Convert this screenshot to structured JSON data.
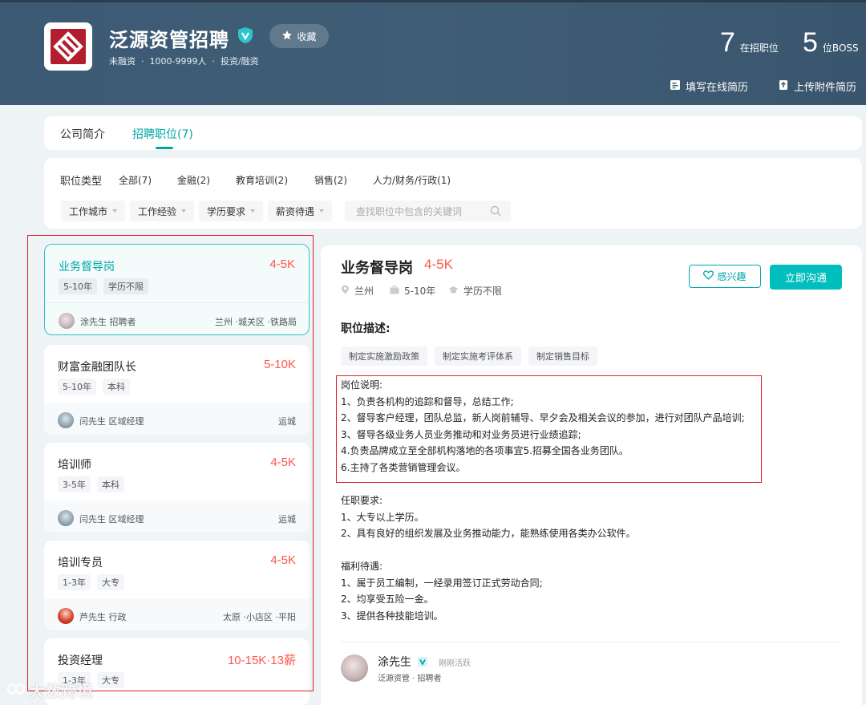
{
  "company": {
    "name": "泛源资管招聘",
    "favorite_label": "收藏",
    "funding": "未融资",
    "size": "1000-9999人",
    "industry": "投资/融资",
    "job_count": "7",
    "job_count_label": "在招职位",
    "boss_count": "5",
    "boss_count_label": "位BOSS",
    "fill_resume_label": "填写在线简历",
    "upload_resume_label": "上传附件简历",
    "meta_dot": "·"
  },
  "tabs": [
    {
      "label": "公司简介"
    },
    {
      "label": "招聘职位(7)"
    }
  ],
  "filters": {
    "type_title": "职位类型",
    "types": [
      "全部(7)",
      "金融(2)",
      "教育培训(2)",
      "销售(2)",
      "人力/财务/行政(1)"
    ],
    "dropdowns": [
      "工作城市",
      "工作经验",
      "学历要求",
      "薪资待遇"
    ],
    "search_placeholder": "查找职位中包含的关键词"
  },
  "jobs": [
    {
      "title": "业务督导岗",
      "salary": "4-5K",
      "tags": [
        "5-10年",
        "学历不限"
      ],
      "recruiter": "涂先生 招聘者",
      "location": "兰州 ·城关区 ·铁路局"
    },
    {
      "title": "财富金融团队长",
      "salary": "5-10K",
      "tags": [
        "5-10年",
        "本科"
      ],
      "recruiter": "闫先生 区域经理",
      "location": "运城"
    },
    {
      "title": "培训师",
      "salary": "4-5K",
      "tags": [
        "3-5年",
        "本科"
      ],
      "recruiter": "闫先生 区域经理",
      "location": "运城"
    },
    {
      "title": "培训专员",
      "salary": "4-5K",
      "tags": [
        "1-3年",
        "大专"
      ],
      "recruiter": "芦先生 行政",
      "location": "太原 ·小店区 ·平阳"
    },
    {
      "title": "投资经理",
      "salary": "10-15K·13薪",
      "tags": [
        "1-3年",
        "大专"
      ],
      "recruiter": "",
      "location": ""
    }
  ],
  "detail": {
    "title": "业务督导岗",
    "salary": "4-5K",
    "city": "兰州",
    "experience": "5-10年",
    "education": "学历不限",
    "interest_label": "感兴趣",
    "chat_label": "立即沟通",
    "section_title": "职位描述:",
    "keywords": [
      "制定实施激励政策",
      "制定实施考评体系",
      "制定销售目标"
    ],
    "duty_lines": [
      "岗位说明:",
      "1、负责各机构的追踪和督导，总结工作;",
      "2、督导客户经理，团队总监，新人岗前辅导、早夕会及相关会议的参加，进行对团队产品培训;",
      "3、督导各级业务人员业务推动和对业务员进行业绩追踪;",
      "4.负责品牌成立至全部机构落地的各项事宜5.招募全国各业务团队。",
      "6.主持了各类营销管理会议。"
    ],
    "requirement_lines": [
      "任职要求:",
      "1、大专以上学历。",
      "2、具有良好的组织发展及业务推动能力，能熟练使用各类办公软件。"
    ],
    "benefit_lines": [
      "福利待遇:",
      "1、属于员工编制，一经录用签订正式劳动合同;",
      "2、均享受五险一金。",
      "3、提供各种技能培训。"
    ],
    "boss_name": "涂先生",
    "boss_status": "刚刚活跃",
    "boss_sub": "泛源资管 · 招聘者"
  },
  "watermark": "大数跨境",
  "colors": {
    "accent": "#00a6a7",
    "salary": "#fe574a",
    "header": "#3e5b73",
    "highlight_box": "#e0202a"
  }
}
